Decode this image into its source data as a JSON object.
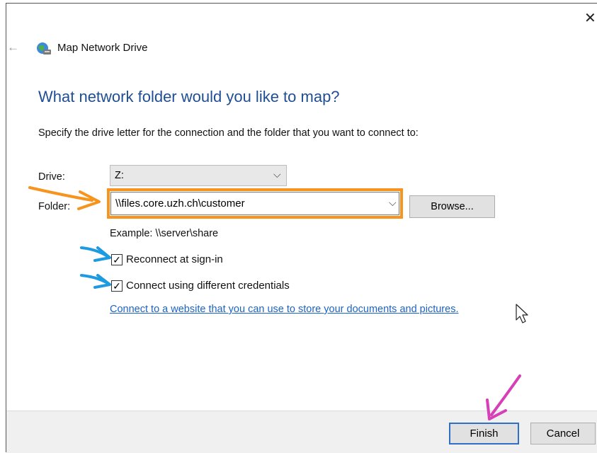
{
  "window": {
    "close_glyph": "✕",
    "back_glyph": "←",
    "title": "Map Network Drive"
  },
  "main": {
    "heading": "What network folder would you like to map?",
    "instruction": "Specify the drive letter for the connection and the folder that you want to connect to:",
    "drive_label": "Drive:",
    "drive_value": "Z:",
    "folder_label": "Folder:",
    "folder_value": "\\\\files.core.uzh.ch\\customer",
    "browse_label": "Browse...",
    "example": "Example: \\\\server\\share",
    "reconnect_label": "Reconnect at sign-in",
    "reconnect_checked": true,
    "credentials_label": "Connect using different credentials",
    "credentials_checked": true,
    "link_text": "Connect to a website that you can use to store your documents and pictures."
  },
  "footer": {
    "finish_label": "Finish",
    "cancel_label": "Cancel"
  },
  "icons": {
    "chevron": "⌵",
    "check": "✓"
  },
  "colors": {
    "heading": "#1f4e94",
    "link": "#1a64c8",
    "folder_highlight": "#f7941d",
    "arrow_orange": "#f7941d",
    "arrow_blue": "#1e9be0",
    "arrow_pink": "#d63fb8",
    "finish_focus": "#2f6fc8"
  }
}
